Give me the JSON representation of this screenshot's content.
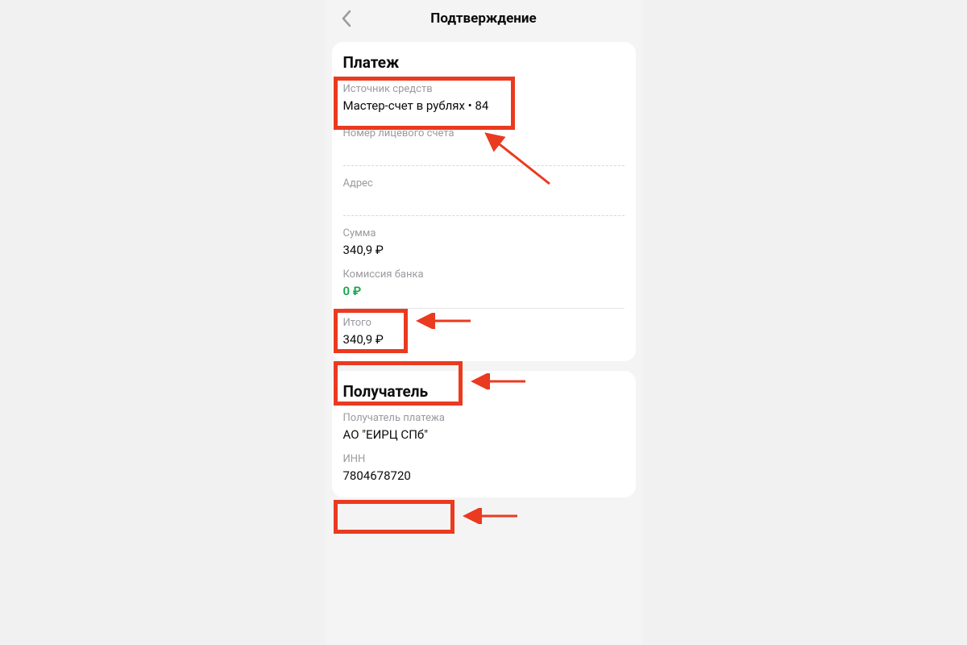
{
  "header": {
    "title": "Подтверждение"
  },
  "payment": {
    "section_title": "Платеж",
    "source_label": "Источник средств",
    "source_value": "Мастер-счет в рублях • 84",
    "account_label": "Номер лицевого счета",
    "account_value": "",
    "address_label": "Адрес",
    "address_value": "",
    "amount_label": "Сумма",
    "amount_value": "340,9 ₽",
    "commission_label": "Комиссия банка",
    "commission_value": "0 ₽",
    "total_label": "Итого",
    "total_value": "340,9 ₽"
  },
  "recipient": {
    "section_title": "Получатель",
    "payee_label": "Получатель платежа",
    "payee_value": "АО \"ЕИРЦ СПб\"",
    "inn_label": "ИНН",
    "inn_value": "7804678720"
  },
  "colors": {
    "annotation": "#ea3a1f",
    "value_green": "#17a54a"
  }
}
